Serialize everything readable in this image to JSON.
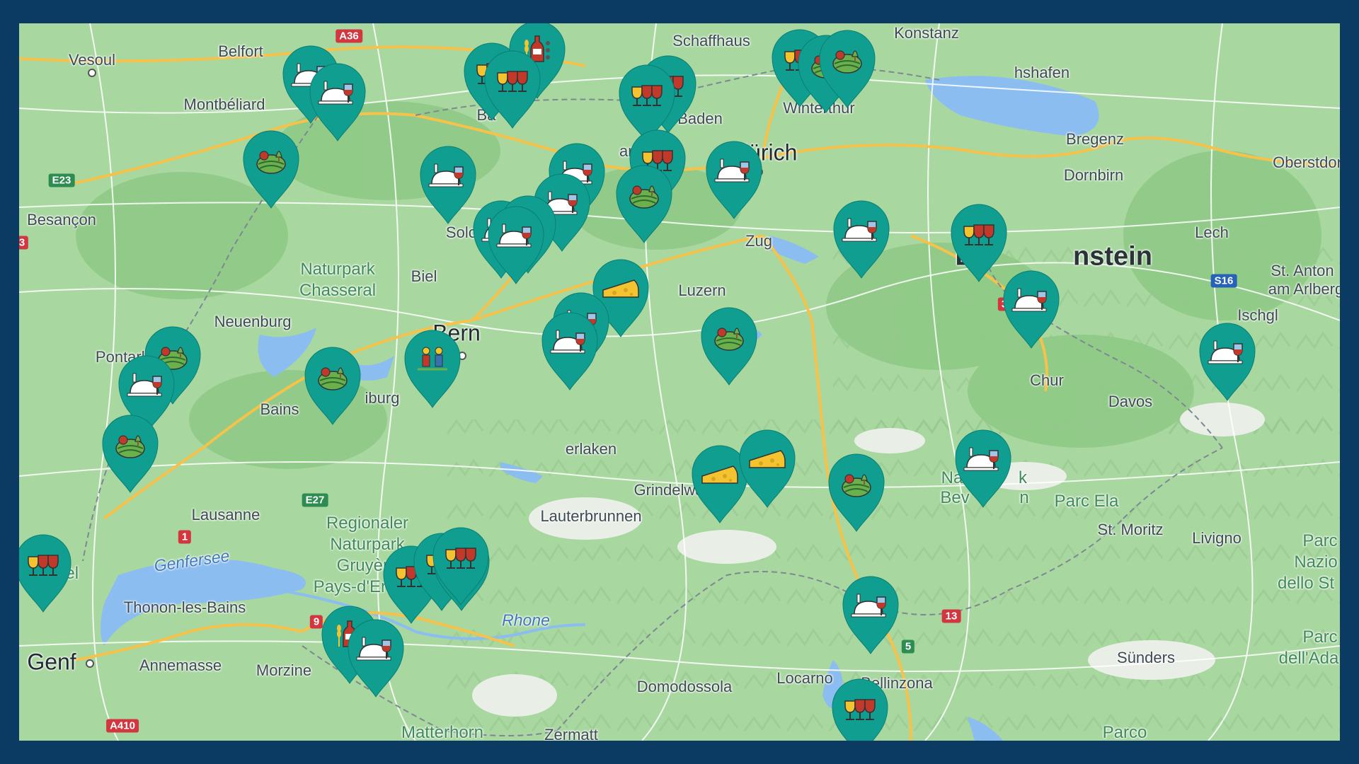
{
  "colors": {
    "frame": "#0b3a63",
    "pin": "#109e90",
    "land": "#a9d7a0",
    "forest": "#8fca86",
    "lake": "#8cbdf0",
    "road_major": "#f6c24a",
    "road_minor": "#ffffff",
    "mountain": "#e9efe7"
  },
  "places": [
    {
      "name": "Vesoul",
      "kind": "city"
    },
    {
      "name": "Belfort",
      "kind": "city"
    },
    {
      "name": "Montbéliard",
      "kind": "city"
    },
    {
      "name": "Besançon",
      "kind": "city"
    },
    {
      "name": "Pontarlier",
      "kind": "city"
    },
    {
      "name": "Neuenburg",
      "kind": "city"
    },
    {
      "name": "Biel",
      "kind": "city"
    },
    {
      "name": "Solothurn",
      "kind": "city"
    },
    {
      "name": "Bern",
      "kind": "city-major"
    },
    {
      "name": "Bains",
      "kind": "city"
    },
    {
      "name": "iburg",
      "kind": "city"
    },
    {
      "name": "Lausanne",
      "kind": "city"
    },
    {
      "name": "Thonon-les-Bains",
      "kind": "city"
    },
    {
      "name": "Genf",
      "kind": "city-major"
    },
    {
      "name": "Annemasse",
      "kind": "city"
    },
    {
      "name": "Morzine",
      "kind": "city"
    },
    {
      "name": "Lauterbrunnen",
      "kind": "city"
    },
    {
      "name": "Grindelwa",
      "kind": "city"
    },
    {
      "name": "erlaken",
      "kind": "city"
    },
    {
      "name": "Matterhorn",
      "kind": "park"
    },
    {
      "name": "Zermatt",
      "kind": "city"
    },
    {
      "name": "Domodossola",
      "kind": "city"
    },
    {
      "name": "Locarno",
      "kind": "city"
    },
    {
      "name": "Bellinzona",
      "kind": "city"
    },
    {
      "name": "Luzern",
      "kind": "city"
    },
    {
      "name": "Zug",
      "kind": "city"
    },
    {
      "name": "Zürich",
      "kind": "city-major"
    },
    {
      "name": "Baden",
      "kind": "city"
    },
    {
      "name": "arau",
      "kind": "city"
    },
    {
      "name": "Ba",
      "kind": "city"
    },
    {
      "name": "Schaffhaus",
      "kind": "city"
    },
    {
      "name": "Winterthur",
      "kind": "city"
    },
    {
      "name": "Konstanz",
      "kind": "city"
    },
    {
      "name": "hshafen",
      "kind": "city"
    },
    {
      "name": "Bregenz",
      "kind": "city"
    },
    {
      "name": "Dornbirn",
      "kind": "city"
    },
    {
      "name": "Oberstdor",
      "kind": "city"
    },
    {
      "name": "Lech",
      "kind": "city"
    },
    {
      "name": "St. Anton",
      "kind": "city"
    },
    {
      "name": "am Arlberg",
      "kind": "city"
    },
    {
      "name": "Ischgl",
      "kind": "city"
    },
    {
      "name": "Chur",
      "kind": "city"
    },
    {
      "name": "Davos",
      "kind": "city"
    },
    {
      "name": "Parc Ela",
      "kind": "park"
    },
    {
      "name": "St. Moritz",
      "kind": "city"
    },
    {
      "name": "Livigno",
      "kind": "city"
    },
    {
      "name": "Sünders",
      "kind": "city"
    },
    {
      "name": "Lie",
      "kind": "country"
    },
    {
      "name": "nstein",
      "kind": "country"
    },
    {
      "name": "Naturpark",
      "kind": "park"
    },
    {
      "name": "Chasseral",
      "kind": "park"
    },
    {
      "name": "Regionaler",
      "kind": "park"
    },
    {
      "name": "Naturpark",
      "kind": "park"
    },
    {
      "name": "Gruyère",
      "kind": "park"
    },
    {
      "name": "Pays-d'En",
      "kind": "park"
    },
    {
      "name": "Na",
      "kind": "park"
    },
    {
      "name": "Bev",
      "kind": "park"
    },
    {
      "name": "k",
      "kind": "park"
    },
    {
      "name": "n",
      "kind": "park"
    },
    {
      "name": "Parc",
      "kind": "park"
    },
    {
      "name": "Nazio",
      "kind": "park"
    },
    {
      "name": "dello St",
      "kind": "park"
    },
    {
      "name": "Parc",
      "kind": "park"
    },
    {
      "name": "dell'Ada",
      "kind": "park"
    },
    {
      "name": "Parco",
      "kind": "park"
    },
    {
      "name": "c naturel",
      "kind": "park"
    },
    {
      "name": "Genfersee",
      "kind": "water"
    },
    {
      "name": "Rhone",
      "kind": "water"
    }
  ],
  "roads": [
    "A36",
    "E23",
    "3",
    "E27",
    "1",
    "9",
    "A410",
    "13",
    "S16",
    "3",
    "5"
  ],
  "pins": [
    {
      "icon": "wine"
    },
    {
      "icon": "bottle-grain"
    },
    {
      "icon": "wine"
    },
    {
      "icon": "wine"
    },
    {
      "icon": "wine"
    },
    {
      "icon": "wine"
    },
    {
      "icon": "vineyard"
    },
    {
      "icon": "vineyard"
    },
    {
      "icon": "wine-dinner"
    },
    {
      "icon": "wine-dinner"
    },
    {
      "icon": "vineyard"
    },
    {
      "icon": "wine-dinner"
    },
    {
      "icon": "wine"
    },
    {
      "icon": "wine-dinner"
    },
    {
      "icon": "wine-dinner"
    },
    {
      "icon": "vineyard"
    },
    {
      "icon": "wine-dinner"
    },
    {
      "icon": "wine-dinner"
    },
    {
      "icon": "barrel"
    },
    {
      "icon": "wine-dinner"
    },
    {
      "icon": "cheese"
    },
    {
      "icon": "wine-dinner"
    },
    {
      "icon": "wine-dinner"
    },
    {
      "icon": "vineyard"
    },
    {
      "icon": "wine-dinner"
    },
    {
      "icon": "wine"
    },
    {
      "icon": "people"
    },
    {
      "icon": "wine-dinner"
    },
    {
      "icon": "vineyard"
    },
    {
      "icon": "wine-dinner"
    },
    {
      "icon": "vineyard"
    },
    {
      "icon": "vineyard"
    },
    {
      "icon": "wine"
    },
    {
      "icon": "wine"
    },
    {
      "icon": "wine"
    },
    {
      "icon": "wine"
    },
    {
      "icon": "wine"
    },
    {
      "icon": "bottle-grain"
    },
    {
      "icon": "wine-dinner"
    },
    {
      "icon": "cheese"
    },
    {
      "icon": "cheese"
    },
    {
      "icon": "vineyard"
    },
    {
      "icon": "wine-dinner"
    },
    {
      "icon": "wine-dinner"
    },
    {
      "icon": "wine-dinner"
    },
    {
      "icon": "wine"
    }
  ]
}
